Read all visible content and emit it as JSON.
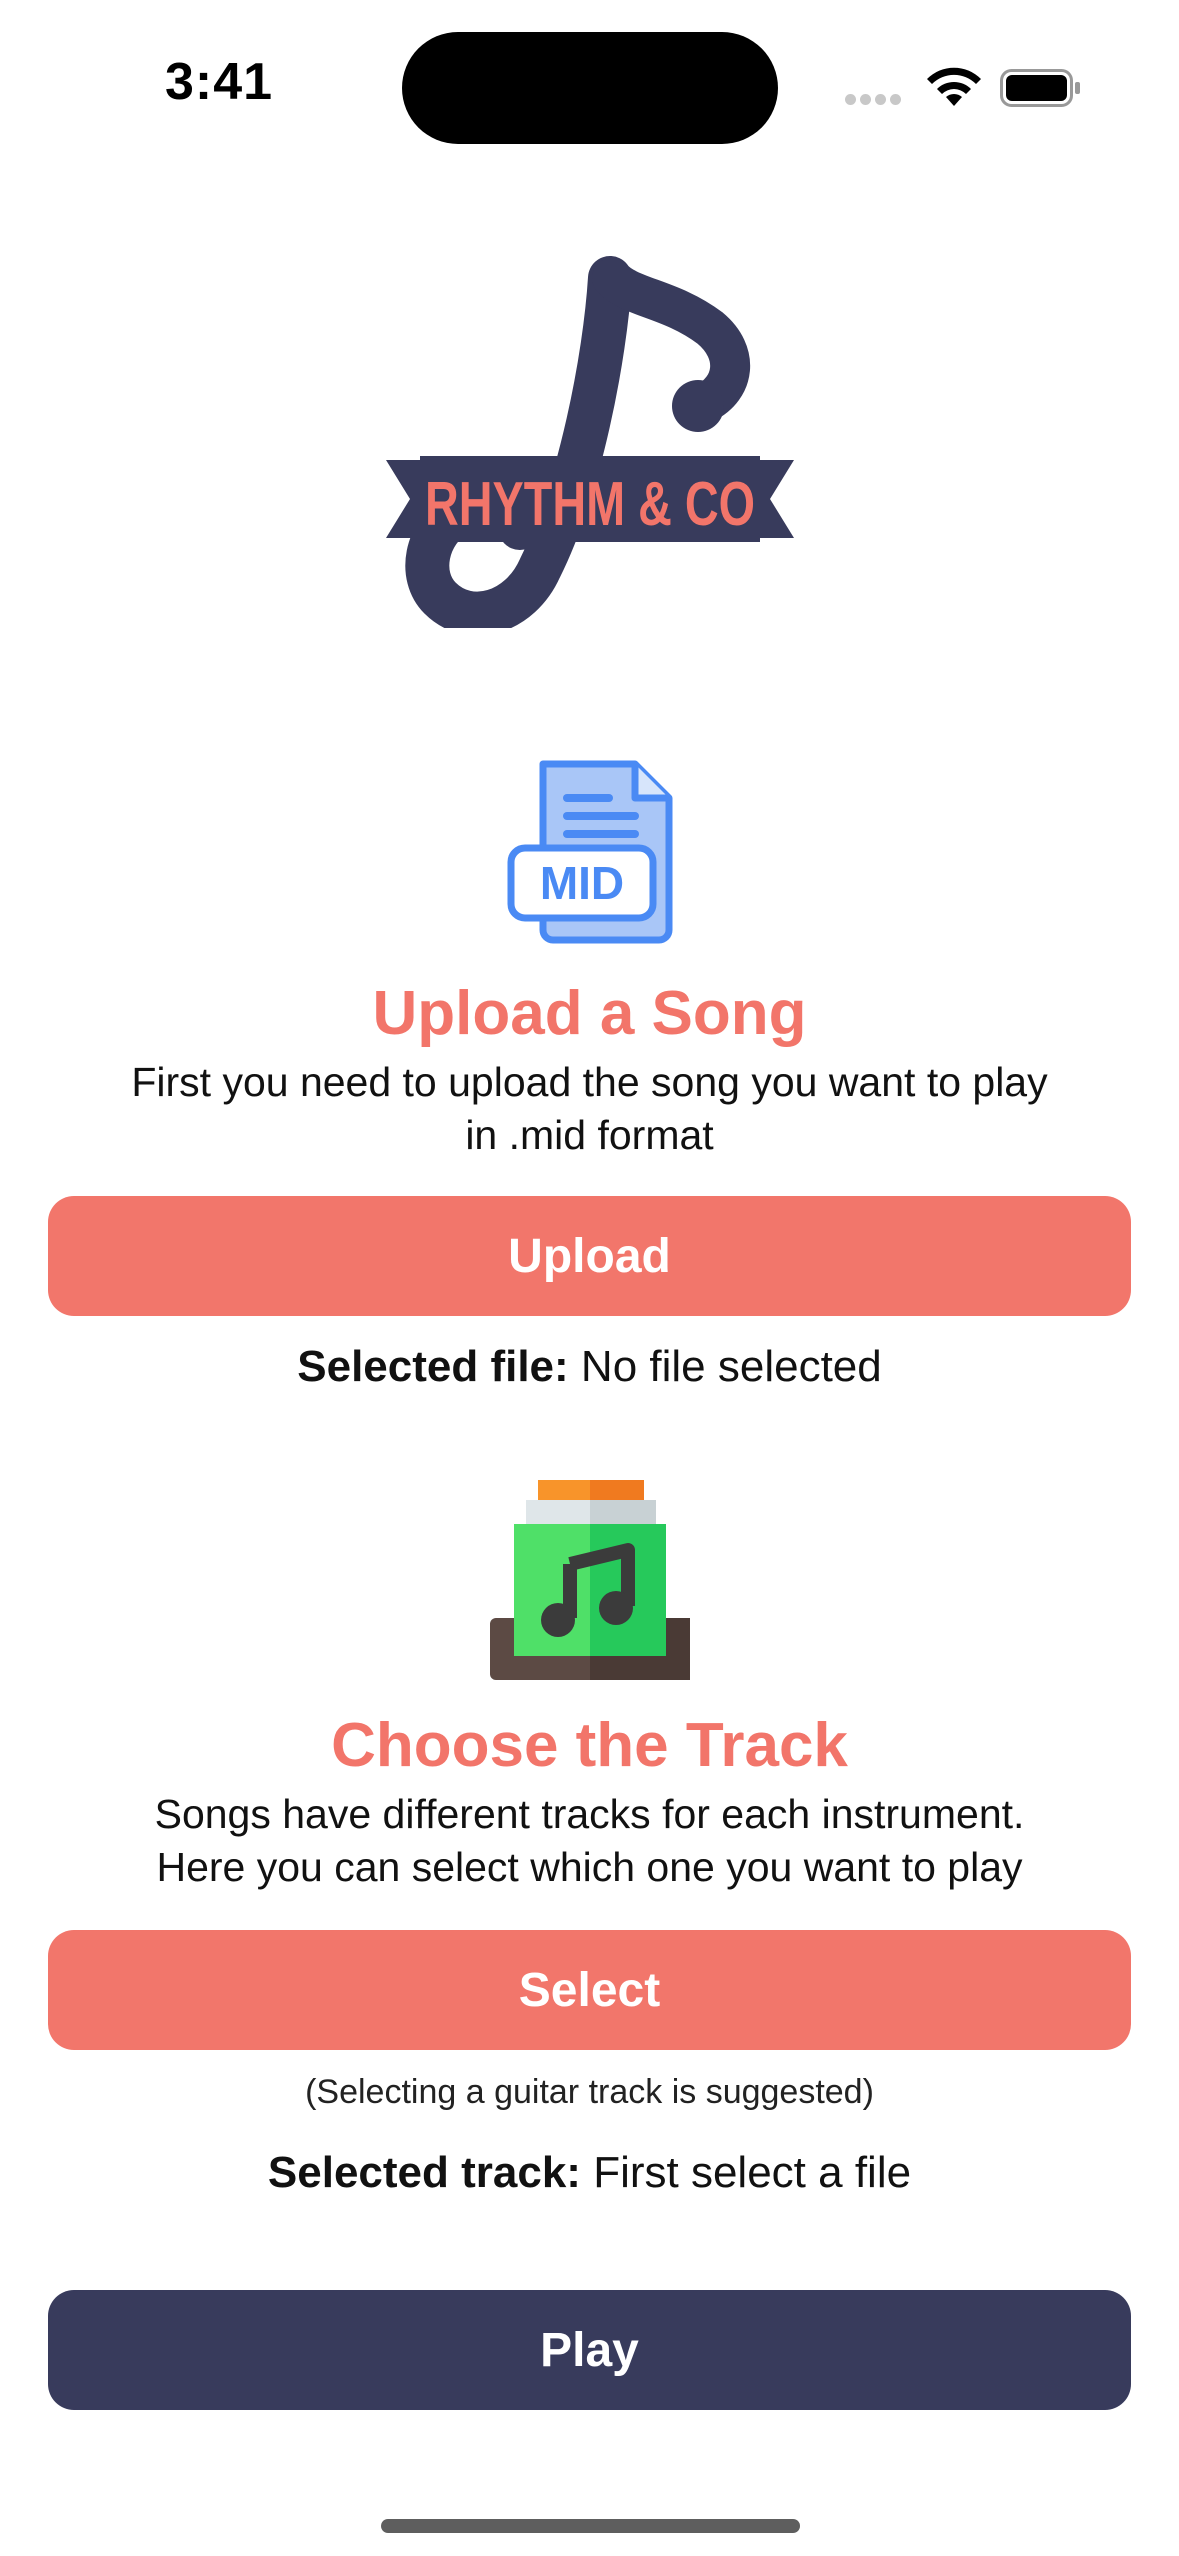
{
  "status_bar": {
    "time": "3:41"
  },
  "logo": {
    "text": "RHYTHM & CO"
  },
  "upload_section": {
    "icon_label": "MID",
    "title": "Upload a Song",
    "description_line1": "First you need to upload the song you want to play",
    "description_line2": "in .mid format",
    "button_label": "Upload",
    "selected_label": "Selected file:",
    "selected_value": "No file selected"
  },
  "track_section": {
    "title": "Choose the Track",
    "description_line1": "Songs have different tracks for each instrument.",
    "description_line2": "Here you can select which one you want to play",
    "button_label": "Select",
    "hint": "(Selecting a guitar track is suggested)",
    "selected_label": "Selected track:",
    "selected_value": "First select a file"
  },
  "play_button_label": "Play",
  "colors": {
    "accent": "#f2766b",
    "navy": "#383b5c",
    "mid_blue": "#4a8af4",
    "green": "#4fe068"
  }
}
